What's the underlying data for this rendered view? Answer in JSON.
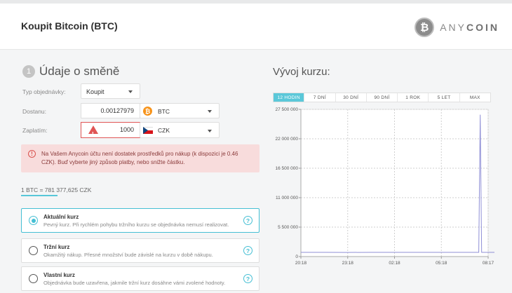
{
  "header": {
    "title": "Koupit Bitcoin (BTC)",
    "logo_symbol": "₿",
    "logo_text_a": "ANY",
    "logo_text_b": "COIN"
  },
  "section": {
    "number": "1",
    "title": "Údaje o směně"
  },
  "form": {
    "order_type_label": "Typ objednávky:",
    "order_type_value": "Koupit",
    "receive_label": "Dostanu:",
    "receive_amount": "0.00127979",
    "receive_currency": "BTC",
    "pay_label": "Zaplatím:",
    "pay_amount": "1000",
    "pay_currency": "CZK"
  },
  "alert": {
    "icon": "!",
    "text": "Na Vašem Anycoin účtu není dostatek prostředků pro nákup (k dispozici je 0.46 CZK). Buď vyberte jiný způsob platby, nebo snižte částku."
  },
  "rate": "1 BTC = 781 377,625 CZK",
  "options": [
    {
      "title": "Aktuální kurz",
      "desc": "Pevný kurz. Při rychlém pohybu tržního kurzu se objednávka nemusí realizovat.",
      "selected": true
    },
    {
      "title": "Tržní kurz",
      "desc": "Okamžitý nákup. Přesné množství bude závislé na kurzu v době nákupu.",
      "selected": false
    },
    {
      "title": "Vlastní kurz",
      "desc": "Objednávka bude uzavřena, jakmile tržní kurz dosáhne vámi zvolené hodnoty.",
      "selected": false
    }
  ],
  "chart": {
    "title": "Vývoj kurzu:",
    "tabs": [
      "12 HODIN",
      "7 DNÍ",
      "30 DNÍ",
      "90 DNÍ",
      "1 ROK",
      "5 LET",
      "MAX"
    ],
    "active_tab": 0
  },
  "colors": {
    "accent": "#45bfd4",
    "error": "#e05555",
    "alert_bg": "#f8dcdc",
    "line": "#8f8fd6"
  },
  "chart_data": {
    "type": "line",
    "title": "",
    "xlabel": "",
    "ylabel": "",
    "x": [
      "20:18",
      "23:18",
      "02:18",
      "05:18",
      "08:17"
    ],
    "ylim": [
      0,
      27500000
    ],
    "yticks": [
      "27 500 000",
      "22 000 000",
      "16 500 000",
      "11 000 000",
      "5 500 000",
      "0"
    ],
    "ytick_values": [
      27500000,
      22000000,
      16500000,
      11000000,
      5500000,
      0
    ],
    "grid": true,
    "series": [
      {
        "name": "",
        "points": [
          [
            0,
            780000
          ],
          [
            0.5,
            781000
          ],
          [
            1,
            779000
          ],
          [
            1.5,
            782000
          ],
          [
            2,
            780500
          ],
          [
            2.5,
            781500
          ],
          [
            3,
            780000
          ],
          [
            3.5,
            782500
          ],
          [
            3.8,
            781000
          ],
          [
            3.83,
            26500000
          ],
          [
            3.86,
            781000
          ],
          [
            4.0,
            781377
          ],
          [
            4.5,
            780000
          ],
          [
            5,
            781377
          ]
        ]
      }
    ]
  }
}
